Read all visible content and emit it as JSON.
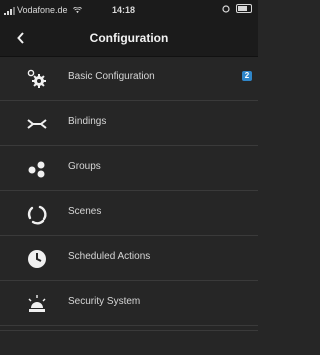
{
  "status_bar": {
    "carrier": "Vodafone.de",
    "time": "14:18"
  },
  "nav": {
    "title": "Configuration"
  },
  "menu": {
    "items": [
      {
        "label": "Basic Configuration",
        "icon": "gears-icon",
        "badge": "2"
      },
      {
        "label": "Bindings",
        "icon": "bindings-icon"
      },
      {
        "label": "Groups",
        "icon": "groups-icon"
      },
      {
        "label": "Scenes",
        "icon": "scenes-icon"
      },
      {
        "label": "Scheduled Actions",
        "icon": "clock-icon"
      },
      {
        "label": "Security System",
        "icon": "alarm-light-icon"
      }
    ]
  }
}
